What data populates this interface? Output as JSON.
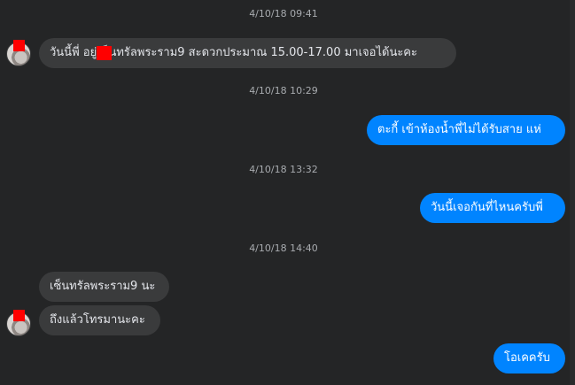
{
  "colors": {
    "background": "#242526",
    "incoming_bubble": "#3a3b3c",
    "outgoing_bubble": "#0084ff",
    "timestamp_text": "#a8abaf"
  },
  "conversation": {
    "timestamps": [
      "4/10/18 09:41",
      "4/10/18 10:29",
      "4/10/18 13:32",
      "4/10/18 14:40"
    ],
    "messages": [
      {
        "direction": "incoming",
        "text": "วันนี้พี่    อยู่เซ็นทรัลพระราม9 สะดวกประมาณ 15.00-17.00 มาเจอได้นะคะ"
      },
      {
        "direction": "outgoing",
        "text": "ตะกี้ เข้าห้องน้ำพี่ไม่ได้รับสาย แห่"
      },
      {
        "direction": "outgoing",
        "text": "วันนี้เจอกันที่ไหนครับพี่"
      },
      {
        "direction": "incoming",
        "text": "เซ็นทรัลพระราม9 นะ"
      },
      {
        "direction": "incoming",
        "text": "ถึงแล้วโทรมานะคะ"
      },
      {
        "direction": "outgoing",
        "text": "โอเคครับ"
      }
    ]
  }
}
